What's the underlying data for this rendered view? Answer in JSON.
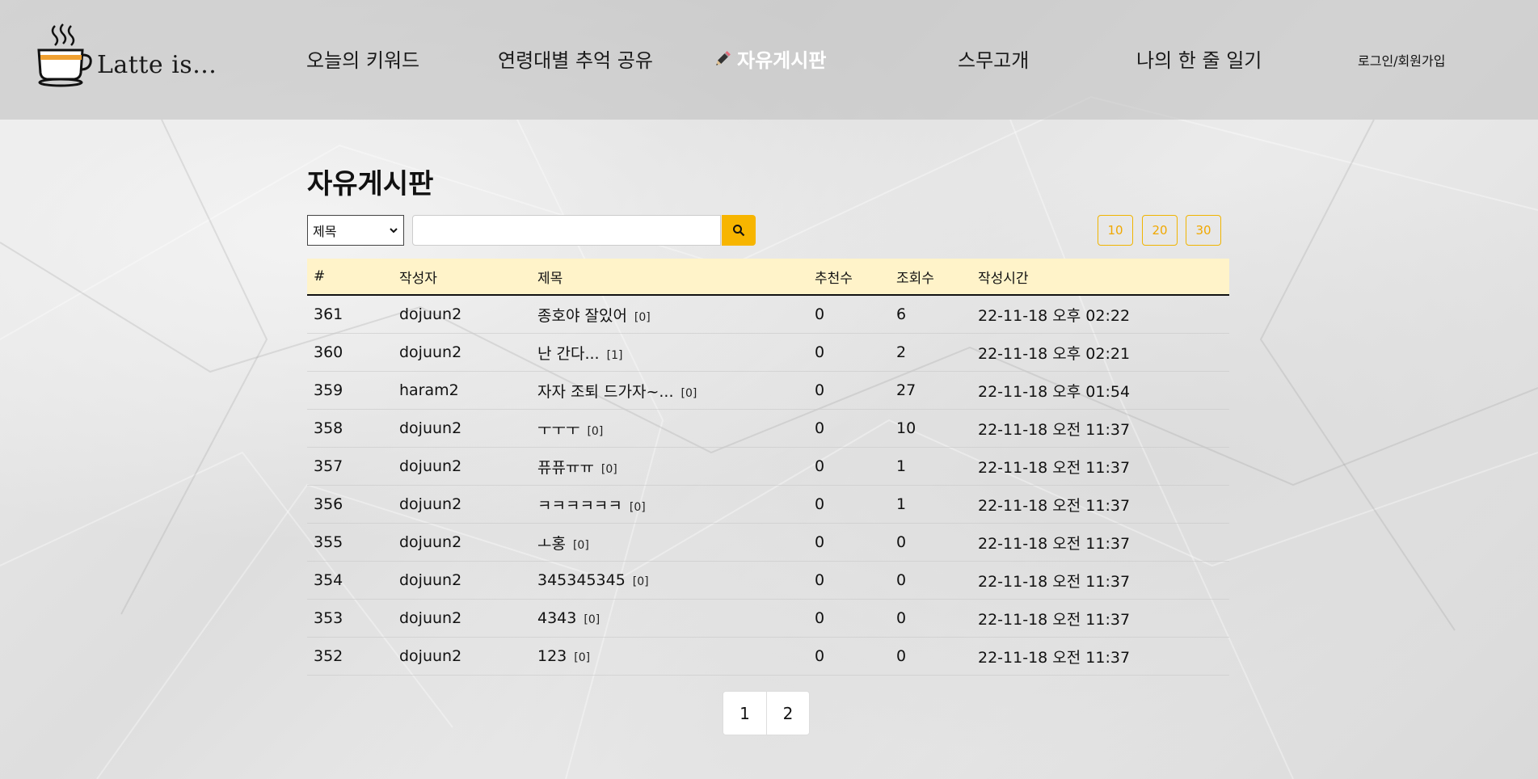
{
  "header": {
    "logo_text": "Latte is...",
    "nav": [
      {
        "label": "오늘의 키워드"
      },
      {
        "label": "연령대별 추억 공유"
      },
      {
        "label": "자유게시판"
      },
      {
        "label": "스무고개"
      },
      {
        "label": "나의 한 줄 일기"
      }
    ],
    "login": "로그인/회원가입"
  },
  "main": {
    "title": "자유게시판",
    "search": {
      "select_value": "제목",
      "input_value": ""
    },
    "page_sizes": [
      "10",
      "20",
      "30"
    ],
    "columns": [
      "#",
      "작성자",
      "제목",
      "추천수",
      "조회수",
      "작성시간"
    ],
    "rows": [
      {
        "num": "361",
        "writer": "dojuun2",
        "title": "종호야 잘있어",
        "comments": "[0]",
        "rec": "0",
        "views": "6",
        "time": "22-11-18 오후 02:22"
      },
      {
        "num": "360",
        "writer": "dojuun2",
        "title": "난 간다...",
        "comments": "[1]",
        "rec": "0",
        "views": "2",
        "time": "22-11-18 오후 02:21"
      },
      {
        "num": "359",
        "writer": "haram2",
        "title": "자자 조퇴 드가자~...",
        "comments": "[0]",
        "rec": "0",
        "views": "27",
        "time": "22-11-18 오후 01:54"
      },
      {
        "num": "358",
        "writer": "dojuun2",
        "title": "ㅜㅜㅜ",
        "comments": "[0]",
        "rec": "0",
        "views": "10",
        "time": "22-11-18 오전 11:37"
      },
      {
        "num": "357",
        "writer": "dojuun2",
        "title": "퓨퓨ㅠㅠ",
        "comments": "[0]",
        "rec": "0",
        "views": "1",
        "time": "22-11-18 오전 11:37"
      },
      {
        "num": "356",
        "writer": "dojuun2",
        "title": "ㅋㅋㅋㅋㅋㅋ",
        "comments": "[0]",
        "rec": "0",
        "views": "1",
        "time": "22-11-18 오전 11:37"
      },
      {
        "num": "355",
        "writer": "dojuun2",
        "title": "ㅗ홍",
        "comments": "[0]",
        "rec": "0",
        "views": "0",
        "time": "22-11-18 오전 11:37"
      },
      {
        "num": "354",
        "writer": "dojuun2",
        "title": "345345345",
        "comments": "[0]",
        "rec": "0",
        "views": "0",
        "time": "22-11-18 오전 11:37"
      },
      {
        "num": "353",
        "writer": "dojuun2",
        "title": "4343",
        "comments": "[0]",
        "rec": "0",
        "views": "0",
        "time": "22-11-18 오전 11:37"
      },
      {
        "num": "352",
        "writer": "dojuun2",
        "title": "123",
        "comments": "[0]",
        "rec": "0",
        "views": "0",
        "time": "22-11-18 오전 11:37"
      }
    ],
    "pages": [
      "1",
      "2"
    ]
  },
  "colors": {
    "accent": "#f7b500",
    "header_row_bg": "#fff3c9",
    "active_nav": "#ffffff"
  },
  "icons": {
    "logo": "coffee-cup-icon",
    "active_nav": "pencil-icon",
    "search": "search-icon",
    "select": "chevron-down-icon"
  }
}
